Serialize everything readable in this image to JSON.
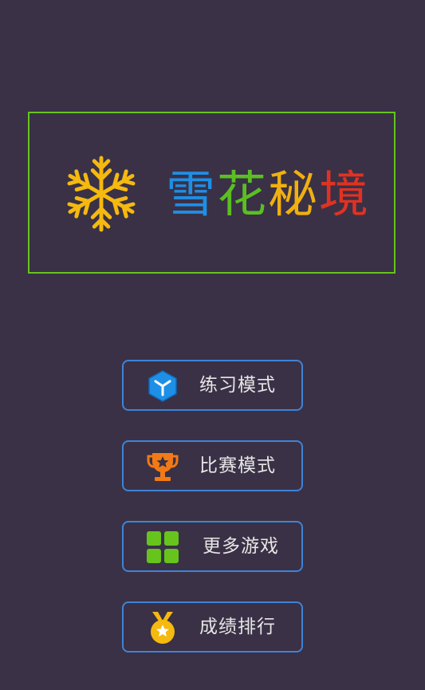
{
  "title": {
    "chars": [
      {
        "char": "雪",
        "color": "#1e8fe6"
      },
      {
        "char": "花",
        "color": "#5bbf22"
      },
      {
        "char": "秘",
        "color": "#f0b010"
      },
      {
        "char": "境",
        "color": "#e03222"
      }
    ],
    "box_color": "#66c41c",
    "snowflake_color": "#f5b90f"
  },
  "menu": [
    {
      "label": "练习模式",
      "icon": "cube-icon",
      "icon_color": "#1e8fe6"
    },
    {
      "label": "比赛模式",
      "icon": "trophy-icon",
      "icon_color": "#f27a16"
    },
    {
      "label": "更多游戏",
      "icon": "grid-icon",
      "icon_color": "#66c41c"
    },
    {
      "label": "成绩排行",
      "icon": "medal-icon",
      "icon_color": "#f5b90f"
    }
  ],
  "colors": {
    "background": "#3a3146",
    "button_border": "#3f83d6",
    "button_text": "#e6e6e6"
  }
}
